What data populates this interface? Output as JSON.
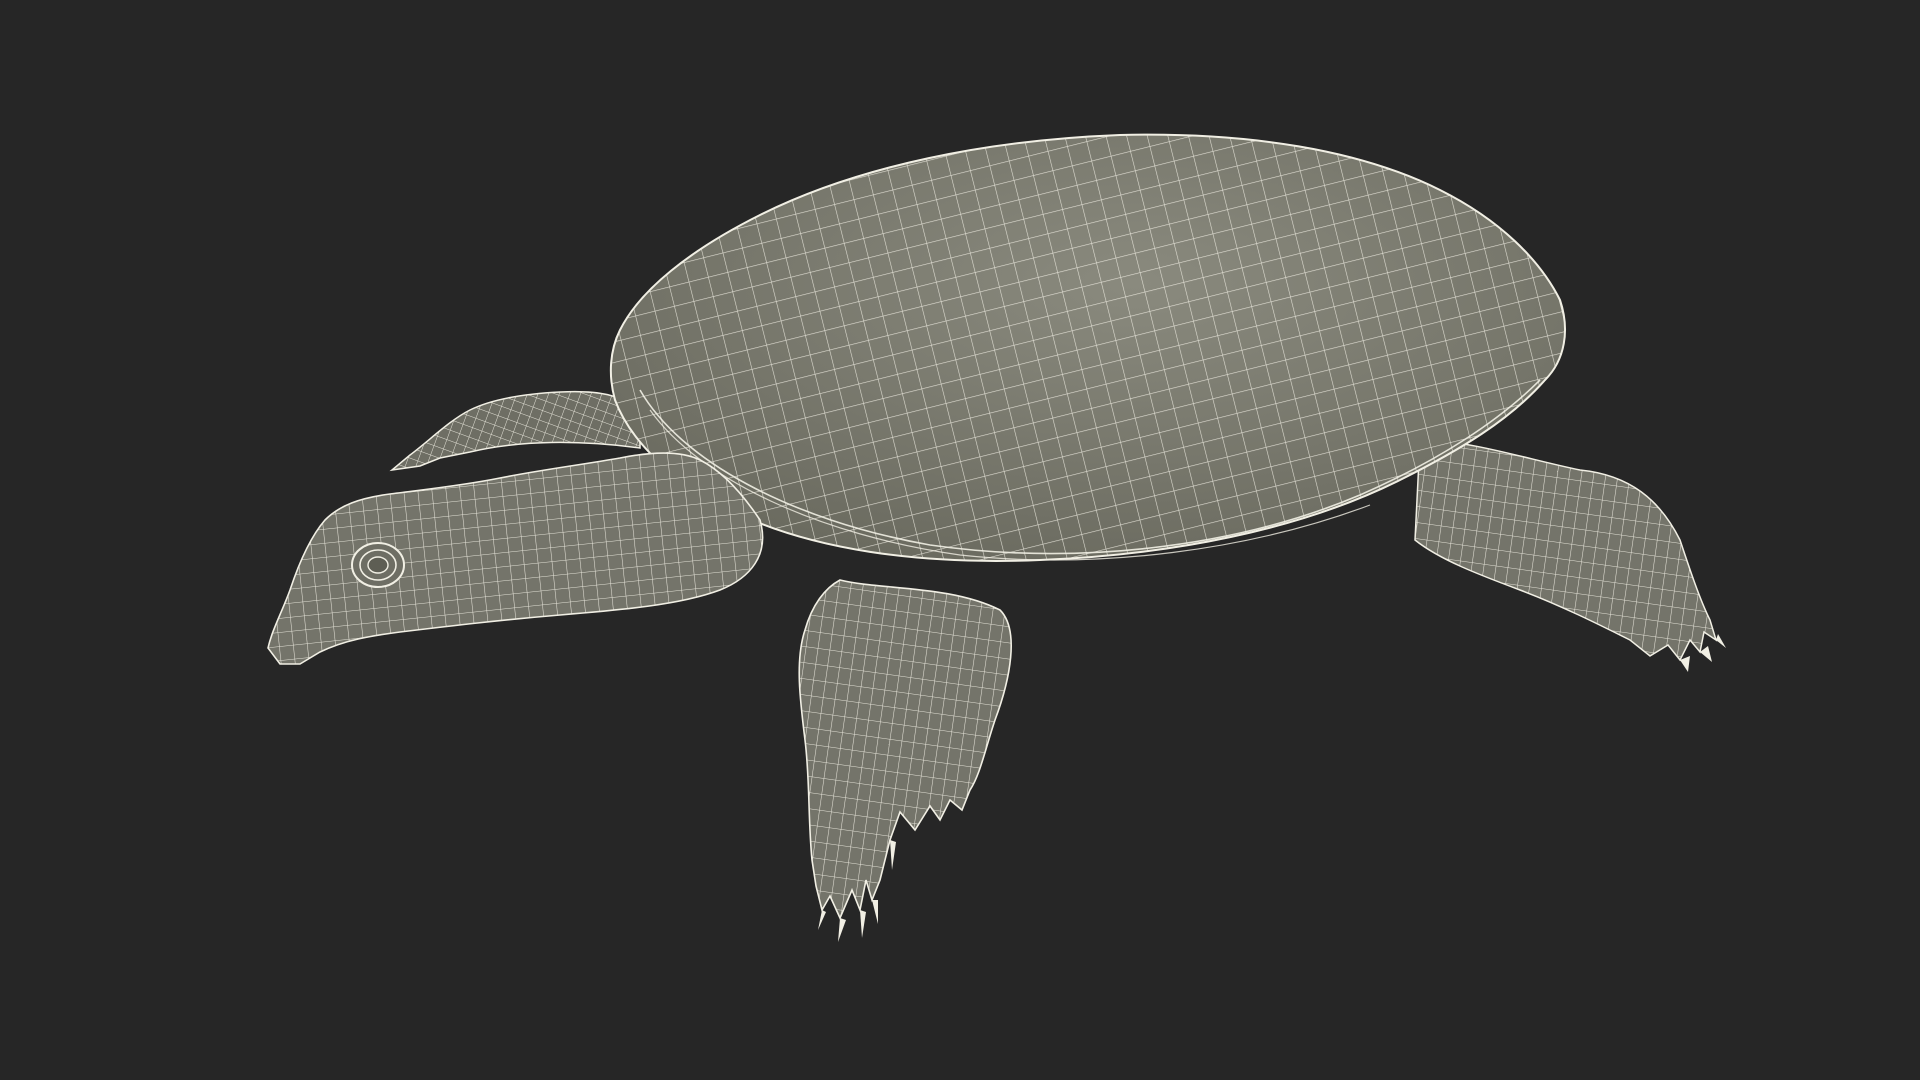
{
  "scene": {
    "subject": "softshell-turtle-wireframe",
    "colors": {
      "background": "#262626",
      "mesh_fill": "#78786c",
      "mesh_fill_dark": "#5e5e54",
      "mesh_fill_light": "#8a8a7e",
      "wire": "#f1efe4",
      "shadow_edge": "#3e3e38"
    }
  }
}
